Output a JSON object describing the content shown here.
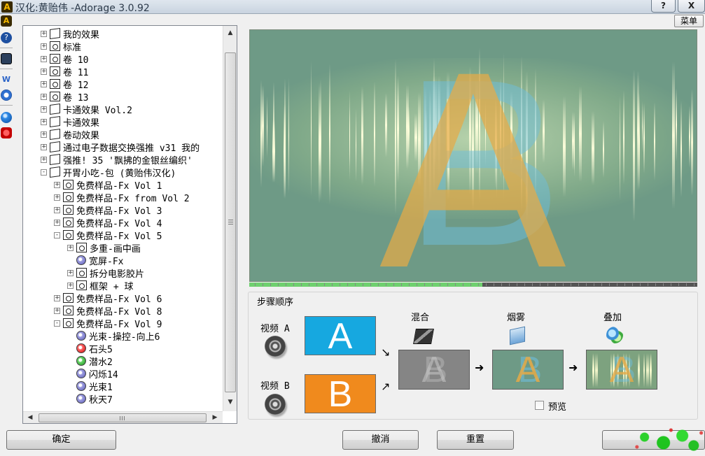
{
  "window": {
    "title": "汉化:黄贻伟 -Adorage 3.0.92",
    "help_label": "?",
    "close_label": "X",
    "app_icon_glyph": "A"
  },
  "menu_button": "菜单",
  "side_toolbar": {
    "icons": [
      "adorage-icon",
      "help-icon",
      "monitor-icon",
      "tools-icon",
      "gear-icon",
      "sphere-icon",
      "stop-icon"
    ]
  },
  "tree": {
    "items": [
      {
        "label": "我的效果",
        "level": 0,
        "expander": "+",
        "icon": "folder"
      },
      {
        "label": "标准",
        "level": 0,
        "expander": "+",
        "icon": "fxfolder"
      },
      {
        "label": "卷 10",
        "level": 0,
        "expander": "+",
        "icon": "fxfolder"
      },
      {
        "label": "卷 11",
        "level": 0,
        "expander": "+",
        "icon": "fxfolder"
      },
      {
        "label": "卷 12",
        "level": 0,
        "expander": "+",
        "icon": "fxfolder"
      },
      {
        "label": "卷 13",
        "level": 0,
        "expander": "+",
        "icon": "fxfolder"
      },
      {
        "label": "卡通效果 Vol.2",
        "level": 0,
        "expander": "+",
        "icon": "folder"
      },
      {
        "label": "卡通效果",
        "level": 0,
        "expander": "+",
        "icon": "folder"
      },
      {
        "label": "卷动效果",
        "level": 0,
        "expander": "+",
        "icon": "folder"
      },
      {
        "label": "通过电子数据交换强推 v31 我的",
        "level": 0,
        "expander": "+",
        "icon": "folder"
      },
      {
        "label": "强推! 35 '飘拂的金银丝编织'",
        "level": 0,
        "expander": "+",
        "icon": "folder"
      },
      {
        "label": "开胃小吃-包 (黄贻伟汉化)",
        "level": 0,
        "expander": "-",
        "icon": "folder"
      },
      {
        "label": "免费样品-Fx Vol 1",
        "level": 1,
        "expander": "+",
        "icon": "fxfolder"
      },
      {
        "label": "免费样品-Fx from Vol 2",
        "level": 1,
        "expander": "+",
        "icon": "fxfolder"
      },
      {
        "label": "免费样品-Fx Vol 3",
        "level": 1,
        "expander": "+",
        "icon": "fxfolder"
      },
      {
        "label": "免费样品-Fx Vol 4",
        "level": 1,
        "expander": "+",
        "icon": "fxfolder"
      },
      {
        "label": "免费样品-Fx Vol 5",
        "level": 1,
        "expander": "-",
        "icon": "fxfolder"
      },
      {
        "label": "多重-画中画",
        "level": 2,
        "expander": "+",
        "icon": "fxfolder"
      },
      {
        "label": "宽屏-Fx",
        "level": 2,
        "expander": "",
        "icon": "disc-purple"
      },
      {
        "label": "拆分电影胶片",
        "level": 2,
        "expander": "+",
        "icon": "fxfolder"
      },
      {
        "label": "框架 + 球",
        "level": 2,
        "expander": "+",
        "icon": "fxfolder"
      },
      {
        "label": "免费样品-Fx Vol 6",
        "level": 1,
        "expander": "+",
        "icon": "fxfolder"
      },
      {
        "label": "免费样品-Fx Vol 8",
        "level": 1,
        "expander": "+",
        "icon": "fxfolder"
      },
      {
        "label": "免费样品-Fx Vol 9",
        "level": 1,
        "expander": "-",
        "icon": "fxfolder"
      },
      {
        "label": "光束-操控-向上6",
        "level": 2,
        "expander": "",
        "icon": "disc-purple"
      },
      {
        "label": "石头5",
        "level": 2,
        "expander": "",
        "icon": "disc-red"
      },
      {
        "label": "潜水2",
        "level": 2,
        "expander": "",
        "icon": "disc-green"
      },
      {
        "label": "闪烁14",
        "level": 2,
        "expander": "",
        "icon": "disc-purple"
      },
      {
        "label": "光束1",
        "level": 2,
        "expander": "",
        "icon": "disc-purple"
      },
      {
        "label": "秋天7",
        "level": 2,
        "expander": "",
        "icon": "disc-purple"
      }
    ]
  },
  "preview": {
    "letter_a": "A",
    "letter_b": "B",
    "progress": 0.52
  },
  "steps": {
    "title": "步骤顺序",
    "video_a_label": "视频 A",
    "video_b_label": "视频 B",
    "source_a_letter": "A",
    "source_b_letter": "B",
    "mix_label": "混合",
    "fog_label": "烟雾",
    "overlay_label": "叠加",
    "arrow_down": "↘",
    "arrow_up": "↗",
    "arrow_right": "➜",
    "preview_checkbox_label": "预览",
    "preview_checked": false
  },
  "buttons": {
    "ok": "确定",
    "undo": "撤消",
    "reset": "重置"
  },
  "scrollbar": {
    "up": "▲",
    "down": "▼",
    "left": "◀",
    "right": "▶"
  }
}
